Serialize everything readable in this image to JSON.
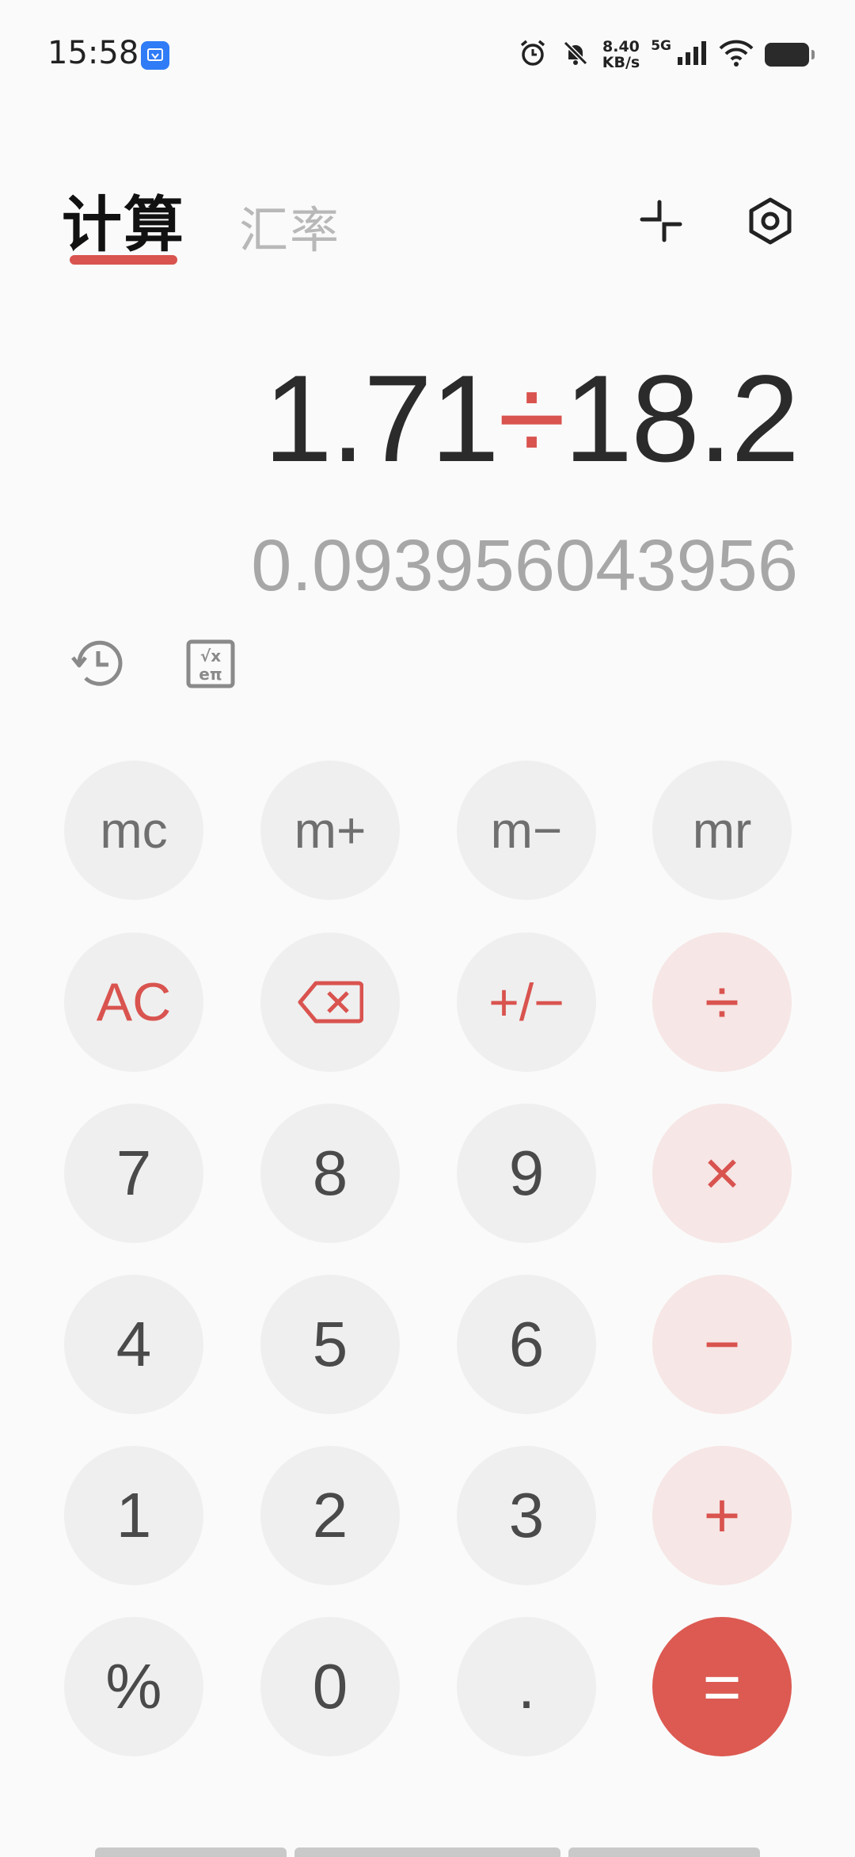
{
  "status_bar": {
    "time": "15:58",
    "network_speed_value": "8.40",
    "network_speed_unit": "KB/s",
    "network_type": "5G",
    "icons": [
      "alarm-icon",
      "bell-muted-icon",
      "signal-icon",
      "wifi-icon",
      "battery-icon"
    ]
  },
  "tabs": {
    "calculate": "计算",
    "exchange_rate": "汇率"
  },
  "top_actions": {
    "collapse_icon": "collapse-icon",
    "settings_icon": "settings-icon"
  },
  "display": {
    "operand1": "1.71",
    "operator": "÷",
    "operand2": "18.2",
    "result": "0.093956043956"
  },
  "tools": {
    "history_icon": "history-icon",
    "scientific_icon": "scientific-icon"
  },
  "keypad": {
    "mc": "mc",
    "m_plus": "m+",
    "m_minus": "m−",
    "mr": "mr",
    "ac": "AC",
    "backspace_icon": "backspace-icon",
    "plus_minus": "+/−",
    "divide": "÷",
    "seven": "7",
    "eight": "8",
    "nine": "9",
    "multiply": "×",
    "four": "4",
    "five": "5",
    "six": "6",
    "minus": "−",
    "one": "1",
    "two": "2",
    "three": "3",
    "plus": "+",
    "percent": "%",
    "zero": "0",
    "dot": ".",
    "equals": "="
  },
  "colors": {
    "accent": "#d9534f",
    "operator_bg": "#f6e6e5",
    "key_bg": "#efefef",
    "equals_bg": "#dc5a52"
  }
}
